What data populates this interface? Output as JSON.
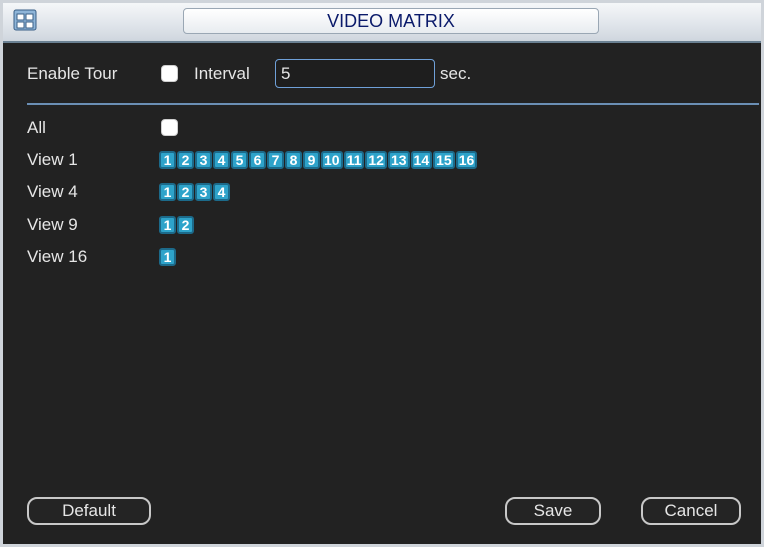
{
  "window": {
    "title": "VIDEO MATRIX"
  },
  "tour": {
    "enable_label": "Enable Tour",
    "interval_label": "Interval",
    "interval_value": "5",
    "unit": "sec."
  },
  "rows": {
    "all": {
      "label": "All"
    },
    "view1": {
      "label": "View 1",
      "channels": [
        "1",
        "2",
        "3",
        "4",
        "5",
        "6",
        "7",
        "8",
        "9",
        "10",
        "11",
        "12",
        "13",
        "14",
        "15",
        "16"
      ]
    },
    "view4": {
      "label": "View 4",
      "channels": [
        "1",
        "2",
        "3",
        "4"
      ]
    },
    "view9": {
      "label": "View 9",
      "channels": [
        "1",
        "2"
      ]
    },
    "view16": {
      "label": "View 16",
      "channels": [
        "1"
      ]
    }
  },
  "buttons": {
    "default": "Default",
    "save": "Save",
    "cancel": "Cancel"
  },
  "colors": {
    "chip": "#2ea3ca",
    "title_text": "#0a1a6a",
    "separator": "#6b8fb5"
  }
}
